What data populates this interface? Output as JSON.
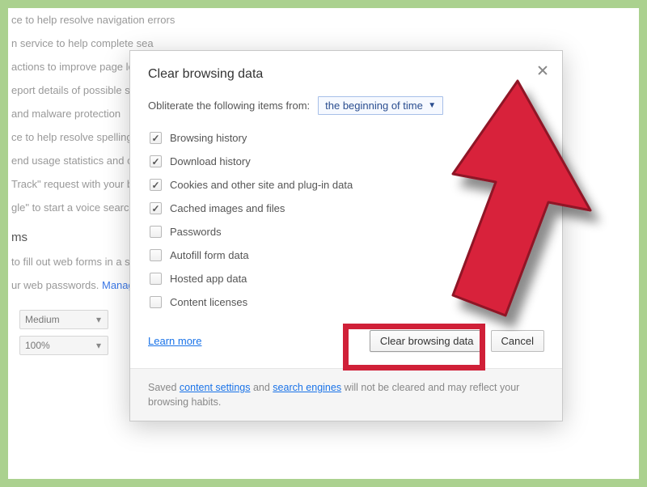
{
  "background": {
    "lines": [
      "ce to help resolve navigation errors",
      "n service to help complete sea",
      "actions to improve page load",
      "eport details of possible secur",
      "and malware protection",
      "ce to help resolve spelling err",
      "end usage statistics and crash",
      "Track\" request with your bro",
      "gle\" to start a voice search"
    ],
    "heading": "ms",
    "line2": "to fill out web forms in a singl",
    "line3_a": "ur web passwords.  ",
    "line3_b": "Manage",
    "selects": {
      "medium": "Medium",
      "zoom": "100%"
    }
  },
  "dialog": {
    "title": "Clear browsing data",
    "obliterate_label": "Obliterate the following items from:",
    "time_range": "the beginning of time",
    "options": [
      {
        "label": "Browsing history",
        "checked": true
      },
      {
        "label": "Download history",
        "checked": true
      },
      {
        "label": "Cookies and other site and plug-in data",
        "checked": true
      },
      {
        "label": "Cached images and files",
        "checked": true
      },
      {
        "label": "Passwords",
        "checked": false
      },
      {
        "label": "Autofill form data",
        "checked": false
      },
      {
        "label": "Hosted app data",
        "checked": false
      },
      {
        "label": "Content licenses",
        "checked": false
      }
    ],
    "learn_more": "Learn more",
    "buttons": {
      "clear": "Clear browsing data",
      "cancel": "Cancel"
    },
    "footer": {
      "a": "Saved ",
      "link1": "content settings",
      "b": " and ",
      "link2": "search engines",
      "c": " will not be cleared and may reflect your browsing habits."
    }
  },
  "annotation": {
    "arrow_color": "#d02038",
    "highlight_color": "#d02038"
  }
}
